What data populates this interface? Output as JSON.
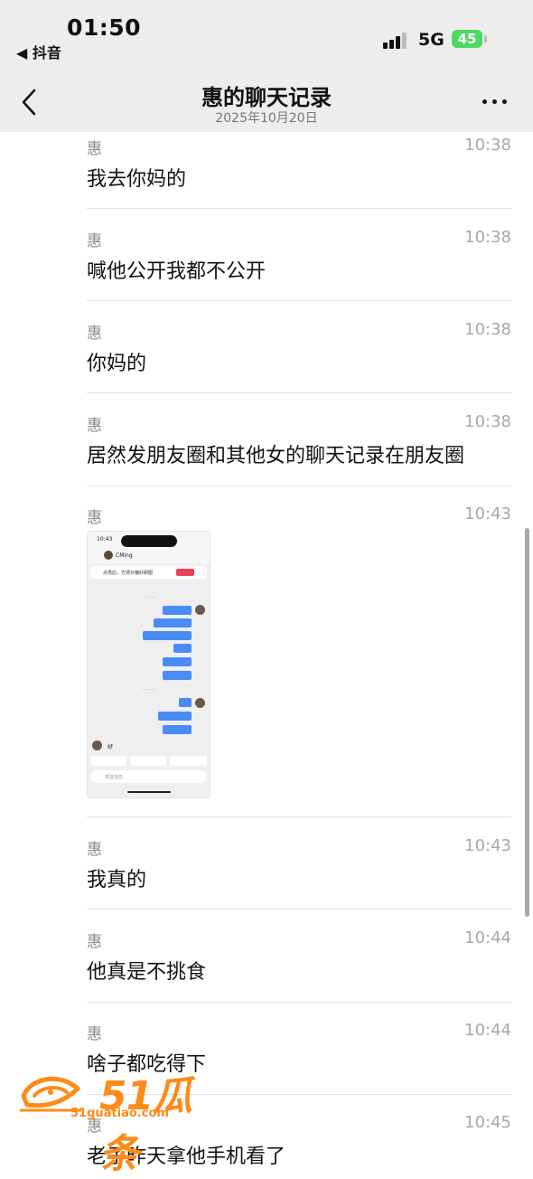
{
  "status": {
    "time": "01:50",
    "back_app": "◀ 抖音",
    "network": "5G",
    "battery": "45"
  },
  "nav": {
    "title": "惠的聊天记录",
    "date": "2025年10月20日"
  },
  "messages": [
    {
      "sender": "惠",
      "time": "10:38",
      "text": "我去你妈的"
    },
    {
      "sender": "惠",
      "time": "10:38",
      "text": "喊他公开我都不公开"
    },
    {
      "sender": "惠",
      "time": "10:38",
      "text": "你妈的"
    },
    {
      "sender": "惠",
      "time": "10:38",
      "text": "居然发朋友圈和其他女的聊天记录在朋友圈"
    },
    {
      "sender": "惠",
      "time": "10:43",
      "text": ""
    },
    {
      "sender": "惠",
      "time": "10:43",
      "text": "我真的"
    },
    {
      "sender": "惠",
      "time": "10:44",
      "text": "他真是不挑食"
    },
    {
      "sender": "惠",
      "time": "10:44",
      "text": "啥子都吃得下"
    },
    {
      "sender": "惠",
      "time": "10:45",
      "text": "老子昨天拿他手机看了"
    }
  ],
  "thumbnail": {
    "status_time": "10:43",
    "contact": "CMing",
    "notice": "点亮后，方便对偏好刷图",
    "bubbles": [
      "分享视频",
      "谁来说的这位",
      "发布过的聊天记录",
      "666",
      "我嘛 我嘛",
      "真的我嘛",
      "申",
      "赶不负方格",
      "我嘛带你"
    ],
    "reply": "好",
    "input_placeholder": "发送消息"
  },
  "watermark": {
    "brand": "51瓜条",
    "url": "51guatiao.com"
  }
}
